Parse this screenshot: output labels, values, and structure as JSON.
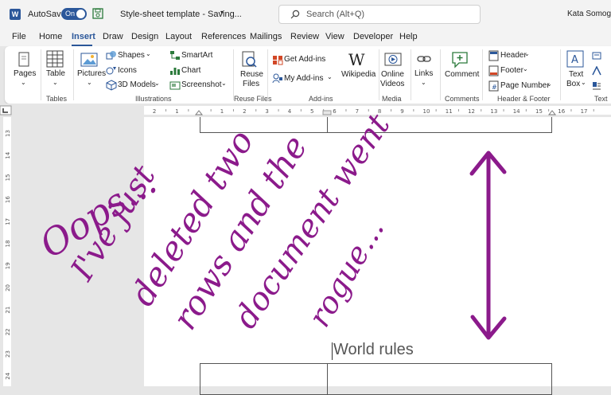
{
  "titlebar": {
    "autosave_label": "AutoSave",
    "autosave_state": "On",
    "document_title": "Style-sheet template - Saving...",
    "search_placeholder": "Search (Alt+Q)",
    "user_name": "Kata Somogyi"
  },
  "menu": {
    "items": [
      "File",
      "Home",
      "Insert",
      "Draw",
      "Design",
      "Layout",
      "References",
      "Mailings",
      "Review",
      "View",
      "Developer",
      "Help"
    ],
    "active": "Insert"
  },
  "ribbon": {
    "pages": "Pages",
    "table": "Table",
    "pictures": "Pictures",
    "shapes": "Shapes",
    "icons": "Icons",
    "models3d": "3D Models",
    "smartart": "SmartArt",
    "chart": "Chart",
    "screenshot": "Screenshot",
    "reuse_files_line1": "Reuse",
    "reuse_files_line2": "Files",
    "get_addins": "Get Add-ins",
    "my_addins": "My Add-ins",
    "wikipedia": "Wikipedia",
    "online_videos_line1": "Online",
    "online_videos_line2": "Videos",
    "links": "Links",
    "comment": "Comment",
    "header": "Header",
    "footer": "Footer",
    "page_number": "Page Number",
    "textbox_line1": "Text",
    "textbox_line2": "Box",
    "groups": {
      "tables": "Tables",
      "illustrations": "Illustrations",
      "reuse_files": "Reuse Files",
      "addins": "Add-ins",
      "media": "Media",
      "comments": "Comments",
      "header_footer": "Header & Footer",
      "text": "Text"
    }
  },
  "document": {
    "heading": "World rules",
    "annotation_lines": [
      "Oops...",
      "I've just",
      "deleted two",
      "rows and the",
      "document went",
      "rogue..."
    ],
    "annotation_color": "#8b1a8b"
  },
  "colors": {
    "accent": "#2b579a",
    "ink": "#8b1a8b"
  }
}
